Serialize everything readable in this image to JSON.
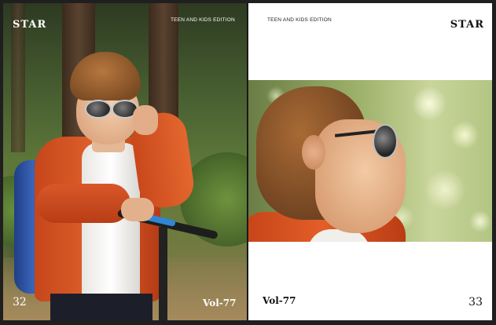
{
  "left_page": {
    "masthead": "STAR",
    "edition": "TEEN AND KIDS EDITION",
    "page_number": "32",
    "volume": "Vol-77"
  },
  "right_page": {
    "masthead": "STAR",
    "edition": "TEEN AND KIDS EDITION",
    "page_number": "33",
    "volume": "Vol-77"
  },
  "colors": {
    "page_white": "#ffffff",
    "jacket_orange": "#e0622b",
    "background": "#1f1f1f"
  },
  "icons": {
    "left_photo": "boy-with-sunglasses-and-scooter-photo",
    "right_photo": "boy-profile-with-sunglasses-photo"
  }
}
